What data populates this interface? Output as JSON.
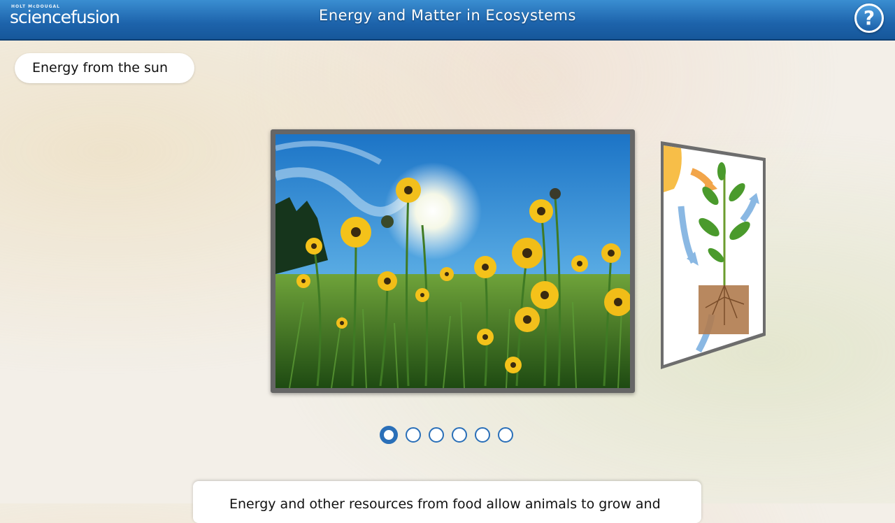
{
  "header": {
    "brand_top": "HOLT McDOUGAL",
    "brand_name": "sciencefusion",
    "title": "Energy and Matter in Ecosystems",
    "help_label": "?"
  },
  "section": {
    "label": "Energy from the sun"
  },
  "slideshow": {
    "slide_count": 6,
    "active_index": 0
  },
  "caption": {
    "text": "Energy and other resources from food allow animals to grow and"
  },
  "colors": {
    "topbar": "#1d63ab",
    "dot": "#2a6fb8"
  }
}
